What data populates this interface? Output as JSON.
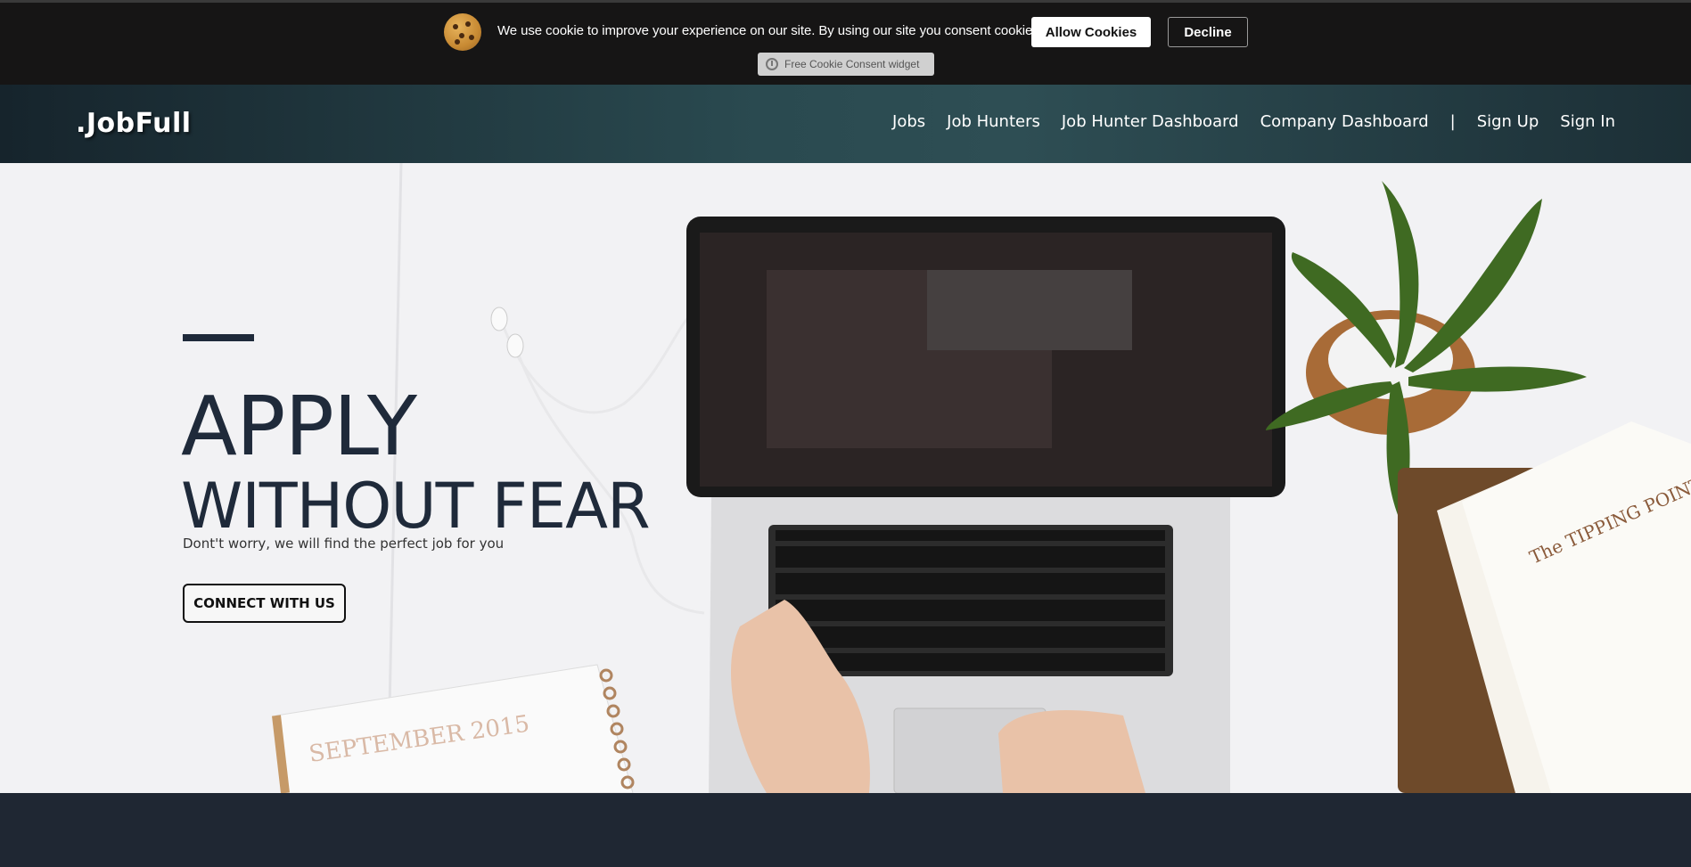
{
  "cookie_banner": {
    "message": "We use cookie to improve your experience on our site. By using our site you consent cookies.",
    "allow_label": "Allow Cookies",
    "decline_label": "Decline",
    "widget_label": "Free Cookie Consent widget",
    "icon": "cookie-icon"
  },
  "navbar": {
    "logo": ".JobFull",
    "links": [
      "Jobs",
      "Job Hunters",
      "Job Hunter Dashboard",
      "Company Dashboard",
      "|",
      "Sign Up",
      "Sign In"
    ]
  },
  "hero": {
    "title_line1": "APPLY",
    "title_line2": "WITHOUT FEAR",
    "subtitle": "Dont't worry, we will find the perfect job for you",
    "cta_label": "CONNECT WITH US",
    "photo_labels": {
      "calendar": "SEPTEMBER 2015",
      "book": "The TIPPING POINT"
    }
  },
  "colors": {
    "cookie_bg": "#161515",
    "nav_teal": "#2a4a50",
    "hero_text": "#1f2a3a",
    "page_dark": "#1f2733"
  }
}
